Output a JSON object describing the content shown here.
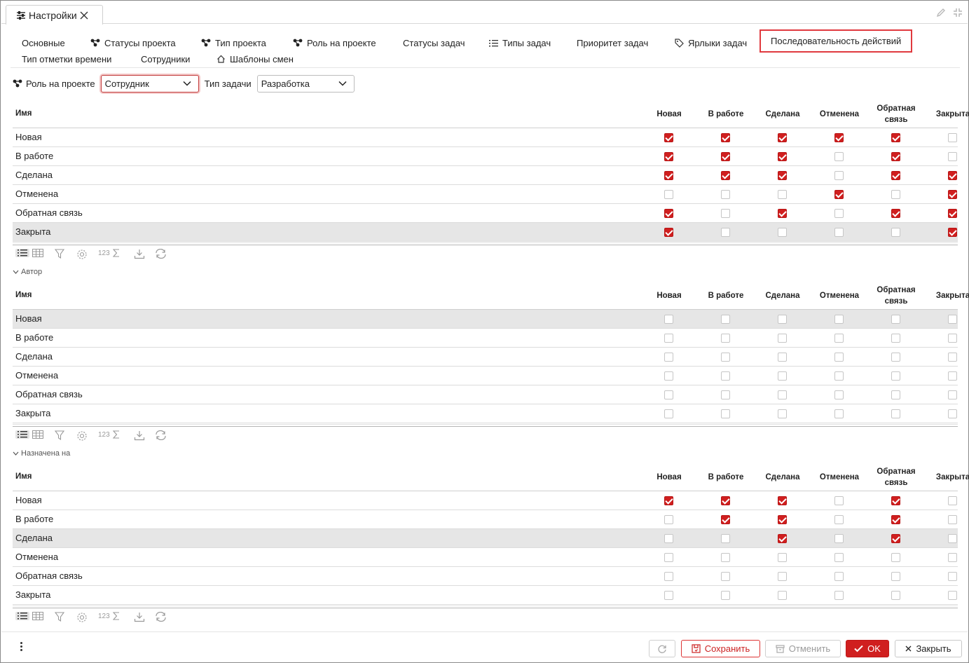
{
  "window": {
    "tab_title": "Настройки"
  },
  "nav": {
    "tabs": [
      {
        "label": "Основные",
        "icon": ""
      },
      {
        "label": "Статусы проекта",
        "icon": "hierarchy-icon"
      },
      {
        "label": "Тип проекта",
        "icon": "hierarchy-icon"
      },
      {
        "label": "Роль на проекте",
        "icon": "hierarchy-icon"
      },
      {
        "label": "Статусы задач",
        "icon": ""
      },
      {
        "label": "Типы задач",
        "icon": "list-icon"
      },
      {
        "label": "Приоритет задач",
        "icon": ""
      },
      {
        "label": "Ярлыки задач",
        "icon": "tag-icon"
      },
      {
        "label": "Последовательность действий",
        "icon": "",
        "active": true
      },
      {
        "label": "Тип отметки времени",
        "icon": ""
      },
      {
        "label": "Сотрудники",
        "icon": ""
      },
      {
        "label": "Шаблоны смен",
        "icon": "home-outline-icon"
      }
    ]
  },
  "filters": {
    "role_label": "Роль на проекте",
    "role_value": "Сотрудник",
    "task_type_label": "Тип задачи",
    "task_type_value": "Разработка"
  },
  "columns": {
    "name": "Имя",
    "statuses": [
      "Новая",
      "В работе",
      "Сделана",
      "Отменена",
      "Обратная связь",
      "Закрыта"
    ]
  },
  "grids": [
    {
      "group": "",
      "highlighted_row": 5,
      "rows": [
        {
          "name": "Новая",
          "checks": [
            true,
            true,
            true,
            true,
            true,
            false
          ]
        },
        {
          "name": "В работе",
          "checks": [
            true,
            true,
            true,
            false,
            true,
            false
          ]
        },
        {
          "name": "Сделана",
          "checks": [
            true,
            true,
            true,
            false,
            true,
            true
          ]
        },
        {
          "name": "Отменена",
          "checks": [
            false,
            false,
            false,
            true,
            false,
            true
          ]
        },
        {
          "name": "Обратная связь",
          "checks": [
            true,
            false,
            true,
            false,
            true,
            true
          ]
        },
        {
          "name": "Закрыта",
          "checks": [
            true,
            false,
            false,
            false,
            false,
            true
          ]
        }
      ]
    },
    {
      "group": "Автор",
      "highlighted_row": 0,
      "rows": [
        {
          "name": "Новая",
          "checks": [
            false,
            false,
            false,
            false,
            false,
            false
          ]
        },
        {
          "name": "В работе",
          "checks": [
            false,
            false,
            false,
            false,
            false,
            false
          ]
        },
        {
          "name": "Сделана",
          "checks": [
            false,
            false,
            false,
            false,
            false,
            false
          ]
        },
        {
          "name": "Отменена",
          "checks": [
            false,
            false,
            false,
            false,
            false,
            false
          ]
        },
        {
          "name": "Обратная связь",
          "checks": [
            false,
            false,
            false,
            false,
            false,
            false
          ]
        },
        {
          "name": "Закрыта",
          "checks": [
            false,
            false,
            false,
            false,
            false,
            false
          ]
        }
      ]
    },
    {
      "group": "Назначена на",
      "highlighted_row": 2,
      "rows": [
        {
          "name": "Новая",
          "checks": [
            true,
            true,
            true,
            false,
            true,
            false
          ]
        },
        {
          "name": "В работе",
          "checks": [
            false,
            true,
            true,
            false,
            true,
            false
          ]
        },
        {
          "name": "Сделана",
          "checks": [
            false,
            false,
            true,
            false,
            true,
            false
          ]
        },
        {
          "name": "Отменена",
          "checks": [
            false,
            false,
            false,
            false,
            false,
            false
          ]
        },
        {
          "name": "Обратная связь",
          "checks": [
            false,
            false,
            false,
            false,
            false,
            false
          ]
        },
        {
          "name": "Закрыта",
          "checks": [
            false,
            false,
            false,
            false,
            false,
            false
          ]
        }
      ]
    }
  ],
  "grid_toolbar": {
    "count_label": "123",
    "icons": [
      "list-view-icon",
      "table-view-icon",
      "filter-icon",
      "settings-icon",
      "sum-icon",
      "download-icon",
      "refresh-icon"
    ]
  },
  "footer": {
    "save": "Сохранить",
    "cancel": "Отменить",
    "ok": "OK",
    "close": "Закрыть"
  },
  "colors": {
    "accent": "#d01f1f",
    "active_tab_border": "#e0393e",
    "row_highlight": "#e6e6e6"
  }
}
